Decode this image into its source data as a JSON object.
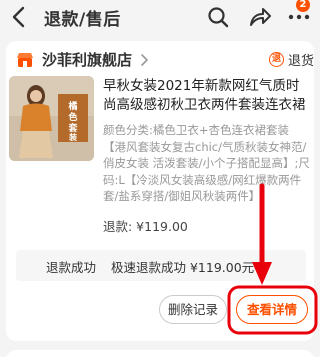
{
  "header": {
    "title": "退款/售后",
    "badge_count": "2",
    "icons": [
      "back-icon",
      "search-icon",
      "share-icon",
      "more-icon"
    ]
  },
  "order": {
    "shop_name": "沙菲利旗舰店",
    "refund_tag_symbol": "退",
    "refund_tag_label": "退货",
    "product_title": "早秋女装2021年新款网红气质时尚高级感初秋卫衣两件套装连衣裙",
    "specs": "颜色分类:橘色卫衣+杏色连衣裙套装【港风套装女复古chic/气质秋装女神范/俏皮女装 活泼套装/小个子搭配显高】;尺码:L【冷淡风女装高级感/网红爆款两件套/盐系穿搭/御姐风秋装两件】",
    "price": "退款: ¥119.00",
    "thumb_text": "橘色套装",
    "status_label": "退款成功",
    "status_text": "极速退款成功 ¥119.00元",
    "btn_delete": "删除记录",
    "btn_detail": "查看详情"
  },
  "colors": {
    "accent": "#ff5000",
    "annotation": "#e8000b"
  }
}
